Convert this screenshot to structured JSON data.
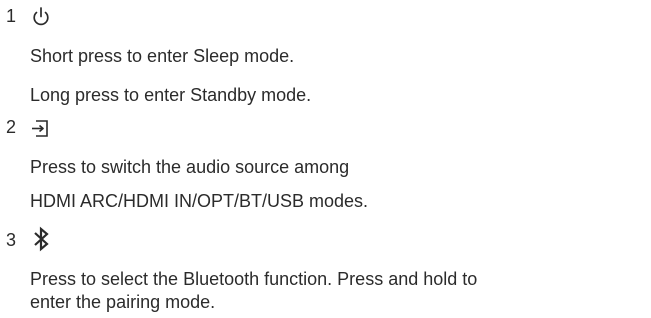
{
  "items": [
    {
      "number": "1",
      "icon": "power-icon",
      "lines": [
        "Short press to enter Sleep mode.",
        "Long press to enter Standby mode."
      ]
    },
    {
      "number": "2",
      "icon": "input-source-icon",
      "lines": [
        "Press to switch the audio source among",
        "HDMI ARC/HDMI IN/OPT/BT/USB modes."
      ]
    },
    {
      "number": "3",
      "icon": "bluetooth-icon",
      "lines": [
        "Press to select the Bluetooth function. Press and hold to",
        "enter the pairing mode."
      ]
    }
  ]
}
